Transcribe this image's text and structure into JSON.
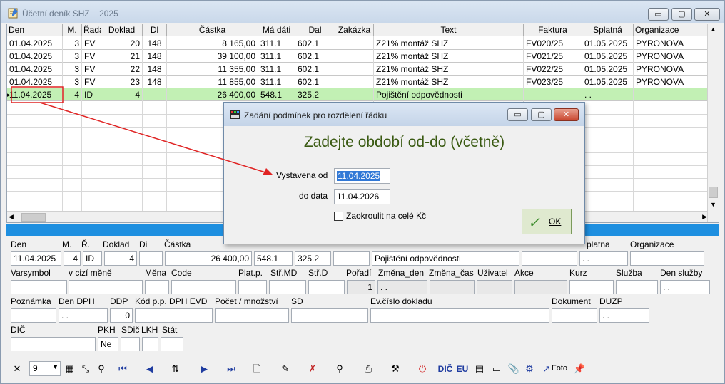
{
  "window": {
    "title": "Účetní deník  SHZ",
    "year": "2025",
    "minimize": "▭",
    "maximize": "▢",
    "close": "✕"
  },
  "grid": {
    "headers": [
      "Den",
      "M.",
      "Řada",
      "Doklad",
      "Dl",
      "Částka",
      "Má dáti",
      "Dal",
      "Zakázka",
      "Text",
      "Faktura",
      "Splatná",
      "Organizace"
    ],
    "rows": [
      [
        "01.04.2025",
        "3",
        "FV",
        "20",
        "148",
        "8 165,00",
        "311.1",
        "602.1",
        "",
        "Z21% montáž SHZ",
        "FV020/25",
        "01.05.2025",
        "PYRONOVA"
      ],
      [
        "01.04.2025",
        "3",
        "FV",
        "21",
        "148",
        "39 100,00",
        "311.1",
        "602.1",
        "",
        "Z21% montáž SHZ",
        "FV021/25",
        "01.05.2025",
        "PYRONOVA"
      ],
      [
        "01.04.2025",
        "3",
        "FV",
        "22",
        "148",
        "11 355,00",
        "311.1",
        "602.1",
        "",
        "Z21% montáž SHZ",
        "FV022/25",
        "01.05.2025",
        "PYRONOVA"
      ],
      [
        "01.04.2025",
        "3",
        "FV",
        "23",
        "148",
        "11 855,00",
        "311.1",
        "602.1",
        "",
        "Z21% montáž SHZ",
        "FV023/25",
        "01.05.2025",
        "PYRONOVA"
      ],
      [
        "11.04.2025",
        "4",
        "ID",
        "4",
        "",
        "26 400,00",
        "548.1",
        "325.2",
        "",
        "Pojištění odpovědnosti",
        "",
        ". .",
        ""
      ]
    ],
    "selected_row_color": "#c2f0b4",
    "highlight_color": "#e02424"
  },
  "form": {
    "labels": {
      "den": "Den",
      "m": "M.",
      "r": "Ř.",
      "doklad": "Doklad",
      "di": "Di",
      "castka": "Částka",
      "splatna": "platna",
      "organizace": "Organizace",
      "varsymbol": "Varsymbol",
      "v_cizi_mene": "v cizí měně",
      "mena": "Měna",
      "code": "Code",
      "plat_p": "Plat.p.",
      "str_md": "Stř.MD",
      "str_d": "Stř.D",
      "poradi": "Pořadí",
      "zmena_den": "Změna_den",
      "zmena_cas": "Změna_čas",
      "uzivatel": "Uživatel",
      "akce": "Akce",
      "kurz": "Kurz",
      "sluzba": "Služba",
      "den_sluzby": "Den služby",
      "poznamka": "Poznámka",
      "den_dph": "Den DPH",
      "ddp": "DDP",
      "kod_pp": "Kód p.p. DPH EVD",
      "pocet": "Počet / množství",
      "sd": "SD",
      "ev_cislo": "Ev.číslo dokladu",
      "dokument": "Dokument",
      "duzp": "DUZP",
      "dic": "DIČ",
      "pkh": "PKH",
      "sdic": "SDič",
      "lkh": "LKH",
      "stat": "Stát"
    },
    "values": {
      "den": "11.04.2025",
      "m": "4",
      "r": "ID",
      "doklad": "4",
      "castka": "26 400,00",
      "md": "548.1",
      "dal": "325.2",
      "text": "Pojištění odpovědnosti",
      "splatna": ". .",
      "poradi": "1",
      "zmena_den": ". .",
      "den_sluzby": ". .",
      "den_dph": ". .",
      "ddp": "0",
      "duzp": ". .",
      "pkh": "Ne"
    }
  },
  "dialog": {
    "title": "Zadání podmínek pro rozdělení řádku",
    "heading": "Zadejte období od-do (včetně)",
    "from_label": "Vystavena od",
    "from_value": "11.04.2025",
    "to_label": "do data",
    "to_value": "11.04.2026",
    "round_label": "Zaokroulit na celé Kč",
    "ok_label": "OK"
  },
  "toolbar": {
    "count_value": "9",
    "dic_label": "DIČ",
    "eu_label": "EU",
    "foto_label": "Foto"
  }
}
